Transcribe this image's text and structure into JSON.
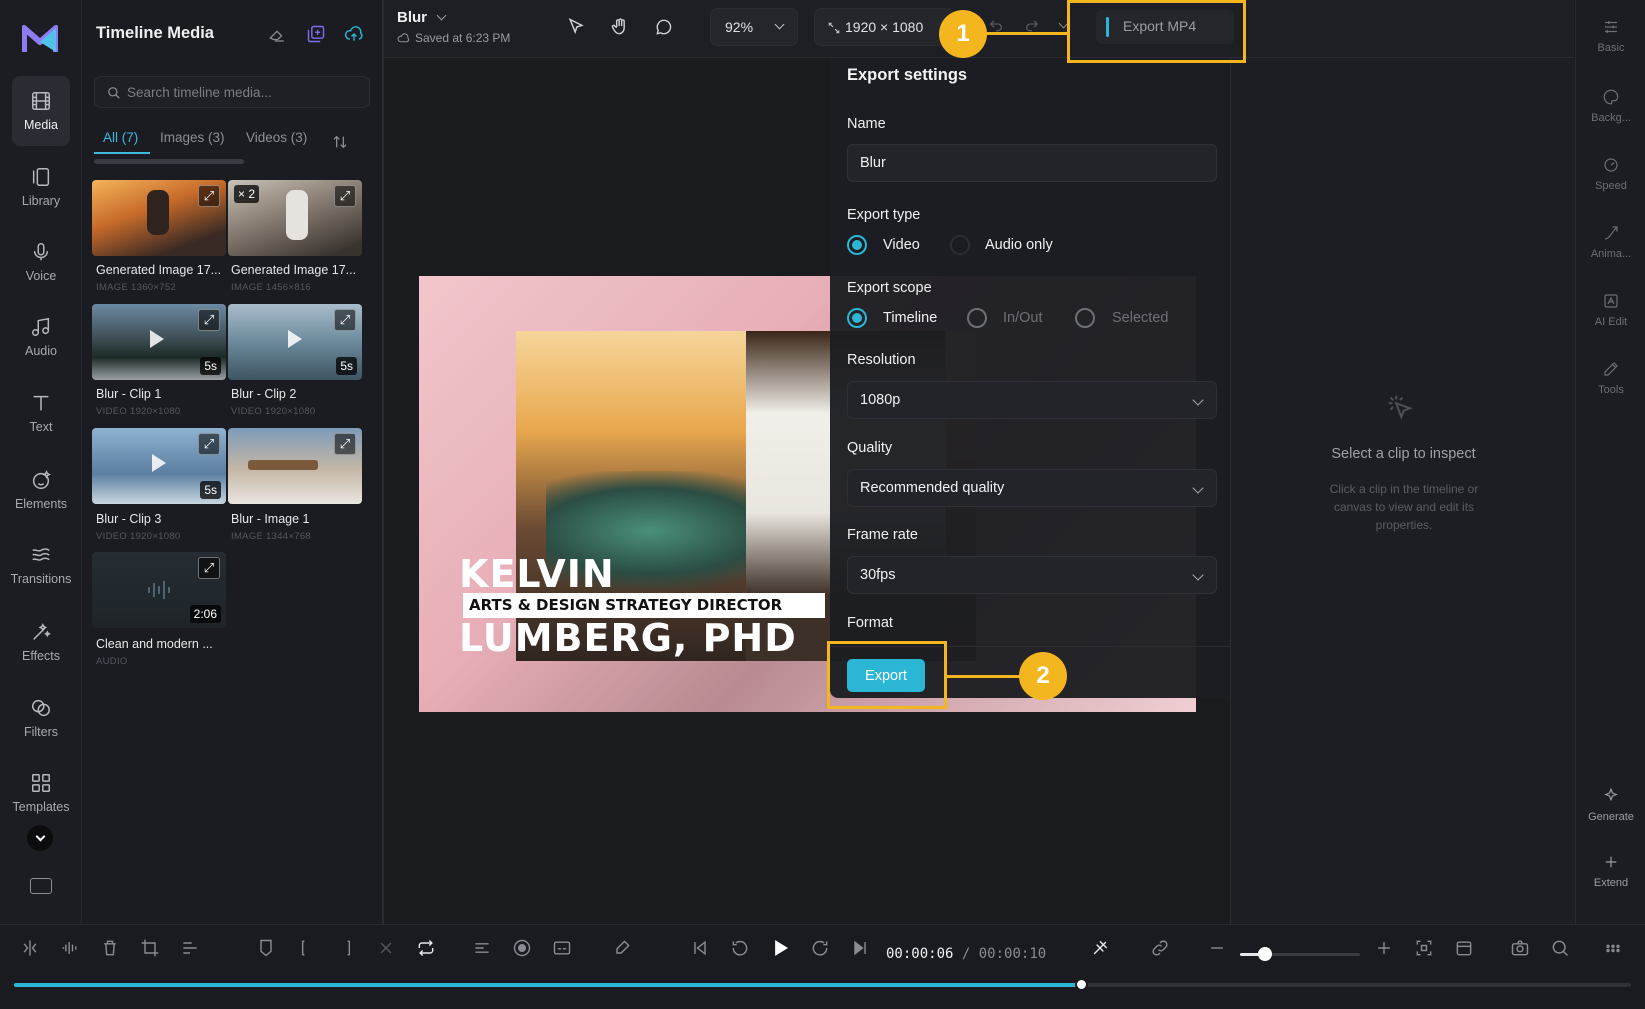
{
  "rail": [
    {
      "label": "Media",
      "icon": "film-icon"
    },
    {
      "label": "Library",
      "icon": "library-icon"
    },
    {
      "label": "Voice",
      "icon": "microphone-icon"
    },
    {
      "label": "Audio",
      "icon": "music-icon"
    },
    {
      "label": "Text",
      "icon": "text-icon"
    },
    {
      "label": "Elements",
      "icon": "elements-icon"
    },
    {
      "label": "Transitions",
      "icon": "transitions-icon"
    },
    {
      "label": "Effects",
      "icon": "effects-icon"
    },
    {
      "label": "Filters",
      "icon": "filters-icon"
    },
    {
      "label": "Templates",
      "icon": "templates-icon"
    }
  ],
  "media": {
    "title": "Timeline Media",
    "search_placeholder": "Search timeline media...",
    "tabs": [
      "All (7)",
      "Images (3)",
      "Videos (3)"
    ],
    "items": [
      {
        "name": "Generated Image 17...",
        "meta": "IMAGE  1360×752",
        "badge": ""
      },
      {
        "name": "Generated Image 17...",
        "meta": "IMAGE  1456×816",
        "badge": "× 2"
      },
      {
        "name": "Blur - Clip 1",
        "meta": "VIDEO  1920×1080",
        "badge": "5s"
      },
      {
        "name": "Blur - Clip 2",
        "meta": "VIDEO  1920×1080",
        "badge": "5s"
      },
      {
        "name": "Blur - Clip 3",
        "meta": "VIDEO  1920×1080",
        "badge": "5s"
      },
      {
        "name": "Blur - Image 1",
        "meta": "IMAGE  1344×768",
        "badge": ""
      },
      {
        "name": "Clean and modern ...",
        "meta": "AUDIO",
        "badge": "2:06"
      }
    ]
  },
  "topbar": {
    "project": "Blur",
    "saved": "Saved at 6:23 PM",
    "zoom": "92%",
    "resolution": "1920 × 1080",
    "export_button": "Export MP4"
  },
  "canvas": {
    "name1": "KELVIN",
    "role": "ARTS & DESIGN STRATEGY DIRECTOR",
    "name2": "LUMBERG, PHD"
  },
  "export": {
    "title": "Export settings",
    "name_label": "Name",
    "name_value": "Blur",
    "type_label": "Export type",
    "type_options": [
      "Video",
      "Audio only"
    ],
    "scope_label": "Export scope",
    "scope_options": [
      "Timeline",
      "In/Out",
      "Selected"
    ],
    "resolution_label": "Resolution",
    "resolution_value": "1080p",
    "quality_label": "Quality",
    "quality_value": "Recommended quality",
    "framerate_label": "Frame rate",
    "framerate_value": "30fps",
    "format_label": "Format",
    "export_button": "Export"
  },
  "inspector": {
    "title": "Select a clip to inspect",
    "hint": "Click a clip in the timeline or canvas to view and edit its properties."
  },
  "right_rail": [
    "Basic",
    "Backg...",
    "Speed",
    "Anima...",
    "AI Edit",
    "Tools",
    "Generate",
    "Extend"
  ],
  "timeline": {
    "current_time": "00:00:06",
    "separator": "/",
    "total_time": "00:00:10",
    "progress": 0.66
  },
  "callouts": [
    "1",
    "2"
  ],
  "colors": {
    "accent": "#2bb6d6",
    "callout": "#f3b61f"
  }
}
